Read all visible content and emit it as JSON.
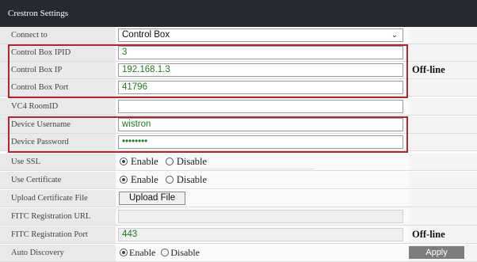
{
  "header": {
    "title": "Crestron Settings"
  },
  "rows": {
    "connect_to": {
      "label": "Connect to",
      "value": "Control Box"
    },
    "control_box_ipid": {
      "label": "Control Box IPID",
      "value": "3"
    },
    "control_box_ip": {
      "label": "Control Box IP",
      "value": "192.168.1.3",
      "status": "Off-line"
    },
    "control_box_port": {
      "label": "Control Box Port",
      "value": "41796"
    },
    "vc4_roomid": {
      "label": "VC4 RoomID",
      "value": ""
    },
    "device_username": {
      "label": "Device Username",
      "value": "wistron"
    },
    "device_password": {
      "label": "Device Password",
      "value": "••••••••"
    },
    "use_ssl": {
      "label": "Use SSL",
      "opt_enable": "Enable",
      "opt_disable": "Disable",
      "selected": "Enable"
    },
    "use_certificate": {
      "label": "Use Certificate",
      "opt_enable": "Enable",
      "opt_disable": "Disable",
      "selected": "Enable"
    },
    "upload_certificate": {
      "label": "Upload Certificate File",
      "button": "Upload File"
    },
    "fitc_url": {
      "label": "FITC Registration URL",
      "value": ""
    },
    "fitc_port": {
      "label": "FITC Registration Port",
      "value": "443",
      "status": "Off-line"
    },
    "auto_discovery": {
      "label": "Auto Discovery",
      "opt_enable": "Enable",
      "opt_disable": "Disable",
      "selected": "Enable",
      "apply": "Apply"
    }
  },
  "colors": {
    "header_bg": "#262930",
    "highlight": "#b5242c",
    "value_text": "#1f7a1f"
  }
}
